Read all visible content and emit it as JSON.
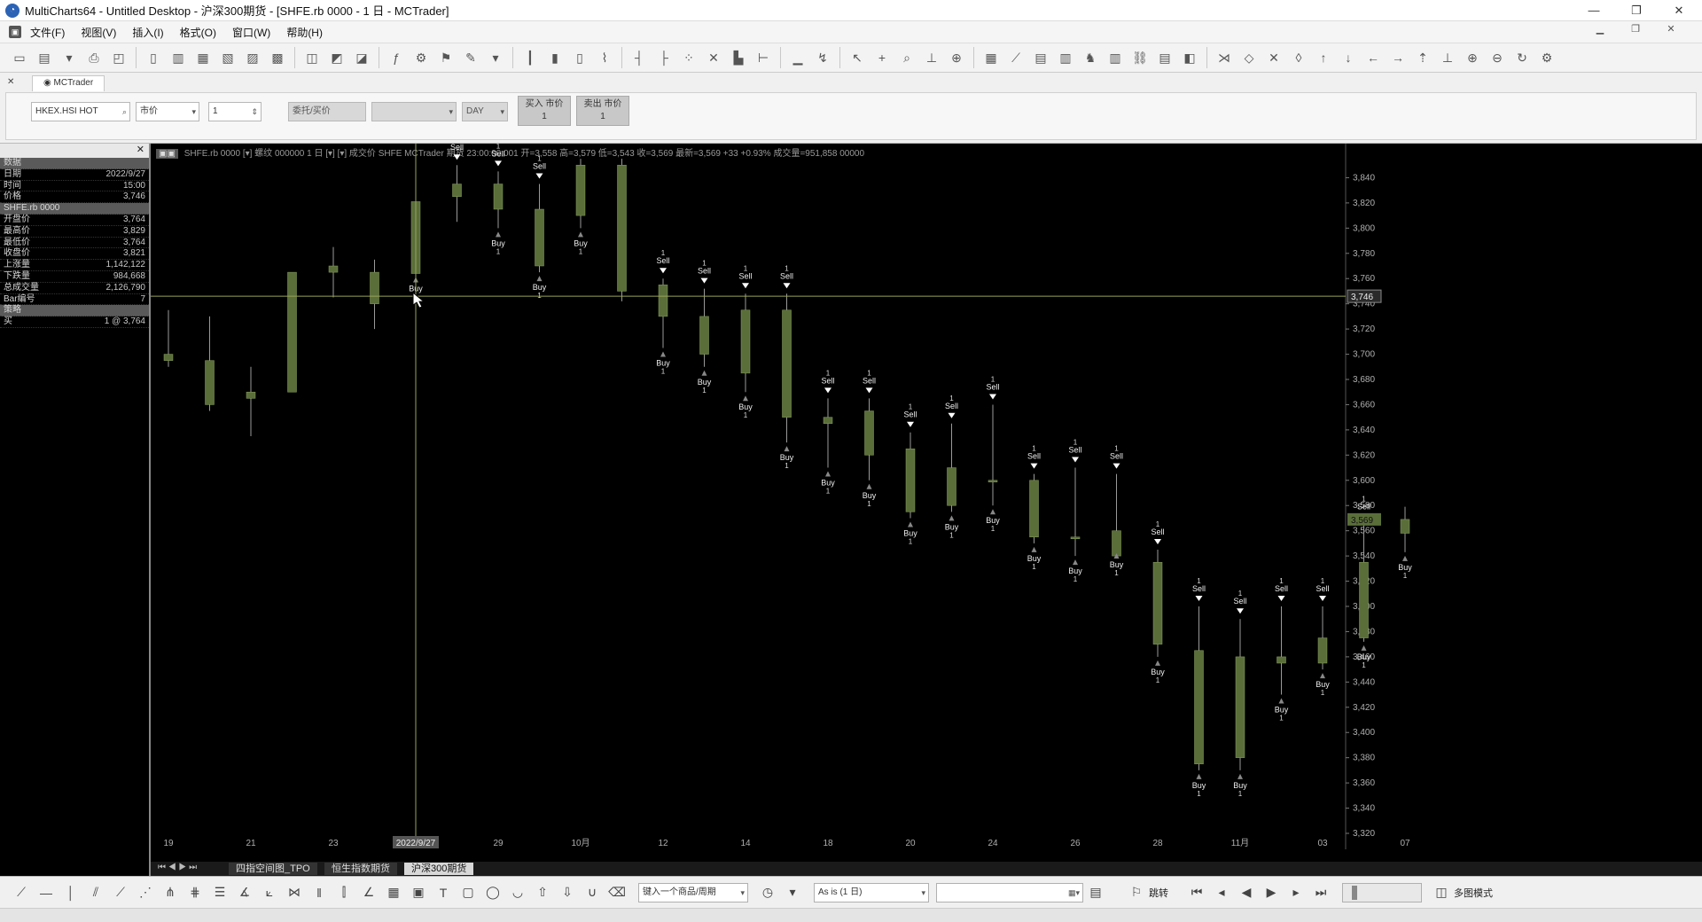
{
  "window": {
    "title": "MultiCharts64 - Untitled Desktop - 沪深300期货 - [SHFE.rb 0000 - 1 日 - MCTrader]",
    "minimize": "—",
    "maximize": "❐",
    "close": "✕"
  },
  "menu": {
    "items": [
      "文件(F)",
      "视图(V)",
      "插入(I)",
      "格式(O)",
      "窗口(W)",
      "帮助(H)"
    ]
  },
  "trader": {
    "tab_label": "MCTrader",
    "close": "✕",
    "symbol": "HKEX.HSI HOT",
    "order_type": "市价",
    "quantity": "1",
    "limit_price_label": "委托/买价",
    "tif": "DAY",
    "buy_button": "买入 市价",
    "buy_qty": "1",
    "sell_button": "卖出 市价",
    "sell_qty": "1"
  },
  "data_window": {
    "close": "✕",
    "rows": [
      {
        "k": "数据",
        "v": "",
        "sec": true
      },
      {
        "k": "日期",
        "v": "2022/9/27"
      },
      {
        "k": "时间",
        "v": "15:00"
      },
      {
        "k": "价格",
        "v": "3,746"
      },
      {
        "k": "SHFE.rb 0000",
        "v": "",
        "sec": true
      },
      {
        "k": "开盘价",
        "v": "3,764"
      },
      {
        "k": "最高价",
        "v": "3,829"
      },
      {
        "k": "最低价",
        "v": "3,764"
      },
      {
        "k": "收盘价",
        "v": "3,821"
      },
      {
        "k": "上涨量",
        "v": "1,142,122"
      },
      {
        "k": "下跌量",
        "v": "984,668"
      },
      {
        "k": "总成交量",
        "v": "2,126,790"
      },
      {
        "k": "Bar编号",
        "v": "7"
      },
      {
        "k": "策略",
        "v": "",
        "sec": true
      },
      {
        "k": "买",
        "v": "1 @ 3,764"
      }
    ]
  },
  "chart": {
    "header": "SHFE.rb 0000 [▾] 螺纹 000000 1 日 [▾] [▾] 成交价  SHFE  MCTrader  期货  23:00:00.001 开=3,558  高=3,579  低=3,543  收=3,569  最新=3,569  +33  +0.93%  成交量=951,858  00000",
    "crosshair_date": "2022/9/27",
    "crosshair_price": "3,746",
    "last_price": "3,569"
  },
  "sheet_tabs": [
    "四指空间图_TPO",
    "恒生指数期货",
    "沪深300期货"
  ],
  "active_sheet": 2,
  "drawbar": {
    "symbol_input": "键入一个商品/周期",
    "resolution": "As is (1 日)",
    "jump_label": "跳转",
    "multi_label": "多图模式"
  },
  "colors": {
    "candle": "#5a6e3a",
    "candle_border": "#8aa060",
    "wick": "#9a9a9a",
    "axis_text": "#b0b0b0",
    "crosshair": "#9aa45a",
    "background": "#000000"
  },
  "chart_data": {
    "type": "candlestick",
    "ylim": [
      3320,
      3860
    ],
    "yticks": [
      3840,
      3820,
      3800,
      3780,
      3760,
      3740,
      3720,
      3700,
      3680,
      3660,
      3640,
      3620,
      3600,
      3580,
      3560,
      3540,
      3520,
      3500,
      3480,
      3460,
      3440,
      3420,
      3400,
      3380,
      3360,
      3340,
      3320
    ],
    "xlabels": [
      {
        "i": 0,
        "label": "19"
      },
      {
        "i": 2,
        "label": "21"
      },
      {
        "i": 4,
        "label": "23"
      },
      {
        "i": 6,
        "label": "2022/9/27"
      },
      {
        "i": 8,
        "label": "29"
      },
      {
        "i": 10,
        "label": "10月"
      },
      {
        "i": 12,
        "label": "12"
      },
      {
        "i": 14,
        "label": "14"
      },
      {
        "i": 16,
        "label": "18"
      },
      {
        "i": 18,
        "label": "20"
      },
      {
        "i": 20,
        "label": "24"
      },
      {
        "i": 22,
        "label": "26"
      },
      {
        "i": 24,
        "label": "28"
      },
      {
        "i": 26,
        "label": "11月"
      },
      {
        "i": 28,
        "label": "03"
      },
      {
        "i": 30,
        "label": "07"
      }
    ],
    "bars": [
      {
        "o": 3700,
        "h": 3735,
        "l": 3690,
        "c": 3695
      },
      {
        "o": 3695,
        "h": 3730,
        "l": 3655,
        "c": 3660
      },
      {
        "o": 3670,
        "h": 3690,
        "l": 3635,
        "c": 3665
      },
      {
        "o": 3670,
        "h": 3765,
        "l": 3670,
        "c": 3765
      },
      {
        "o": 3765,
        "h": 3785,
        "l": 3745,
        "c": 3770
      },
      {
        "o": 3765,
        "h": 3775,
        "l": 3720,
        "c": 3740
      },
      {
        "o": 3764,
        "h": 3829,
        "l": 3764,
        "c": 3821,
        "buy": true
      },
      {
        "o": 3825,
        "h": 3850,
        "l": 3805,
        "c": 3835,
        "sell": true
      },
      {
        "o": 3835,
        "h": 3845,
        "l": 3800,
        "c": 3815,
        "sell": true,
        "buy": true
      },
      {
        "o": 3815,
        "h": 3835,
        "l": 3765,
        "c": 3770,
        "sell": true,
        "buy": true
      },
      {
        "o": 3810,
        "h": 3855,
        "l": 3800,
        "c": 3850,
        "buy": true
      },
      {
        "o": 3850,
        "h": 3855,
        "l": 3742,
        "c": 3750
      },
      {
        "o": 3755,
        "h": 3760,
        "l": 3705,
        "c": 3730,
        "sell": true,
        "buy": true
      },
      {
        "o": 3730,
        "h": 3752,
        "l": 3690,
        "c": 3700,
        "sell": true,
        "buy": true
      },
      {
        "o": 3735,
        "h": 3748,
        "l": 3670,
        "c": 3685,
        "sell": true,
        "buy": true
      },
      {
        "o": 3735,
        "h": 3748,
        "l": 3630,
        "c": 3650,
        "sell": true,
        "buy": true
      },
      {
        "o": 3645,
        "h": 3665,
        "l": 3610,
        "c": 3650,
        "sell": true,
        "buy": true
      },
      {
        "o": 3655,
        "h": 3665,
        "l": 3600,
        "c": 3620,
        "sell": true,
        "buy": true
      },
      {
        "o": 3625,
        "h": 3638,
        "l": 3570,
        "c": 3575,
        "sell": true,
        "buy": true
      },
      {
        "o": 3610,
        "h": 3645,
        "l": 3575,
        "c": 3580,
        "sell": true,
        "buy": true
      },
      {
        "o": 3600,
        "h": 3660,
        "l": 3580,
        "c": 3600,
        "sell": true,
        "buy": true
      },
      {
        "o": 3600,
        "h": 3605,
        "l": 3550,
        "c": 3555,
        "sell": true,
        "buy": true
      },
      {
        "o": 3555,
        "h": 3610,
        "l": 3540,
        "c": 3555,
        "sell": true,
        "buy": true
      },
      {
        "o": 3560,
        "h": 3605,
        "l": 3545,
        "c": 3540,
        "sell": true,
        "buy": true
      },
      {
        "o": 3535,
        "h": 3545,
        "l": 3460,
        "c": 3470,
        "sell": true,
        "buy": true
      },
      {
        "o": 3465,
        "h": 3500,
        "l": 3370,
        "c": 3375,
        "sell": true,
        "buy": true
      },
      {
        "o": 3460,
        "h": 3490,
        "l": 3370,
        "c": 3380,
        "sell": true,
        "buy": true
      },
      {
        "o": 3460,
        "h": 3500,
        "l": 3430,
        "c": 3455,
        "sell": true,
        "buy": true
      },
      {
        "o": 3475,
        "h": 3500,
        "l": 3450,
        "c": 3455,
        "sell": true,
        "buy": true
      },
      {
        "o": 3535,
        "h": 3565,
        "l": 3472,
        "c": 3475,
        "sell": true,
        "buy": true
      },
      {
        "o": 3558,
        "h": 3579,
        "l": 3543,
        "c": 3569,
        "buy": true
      }
    ]
  }
}
